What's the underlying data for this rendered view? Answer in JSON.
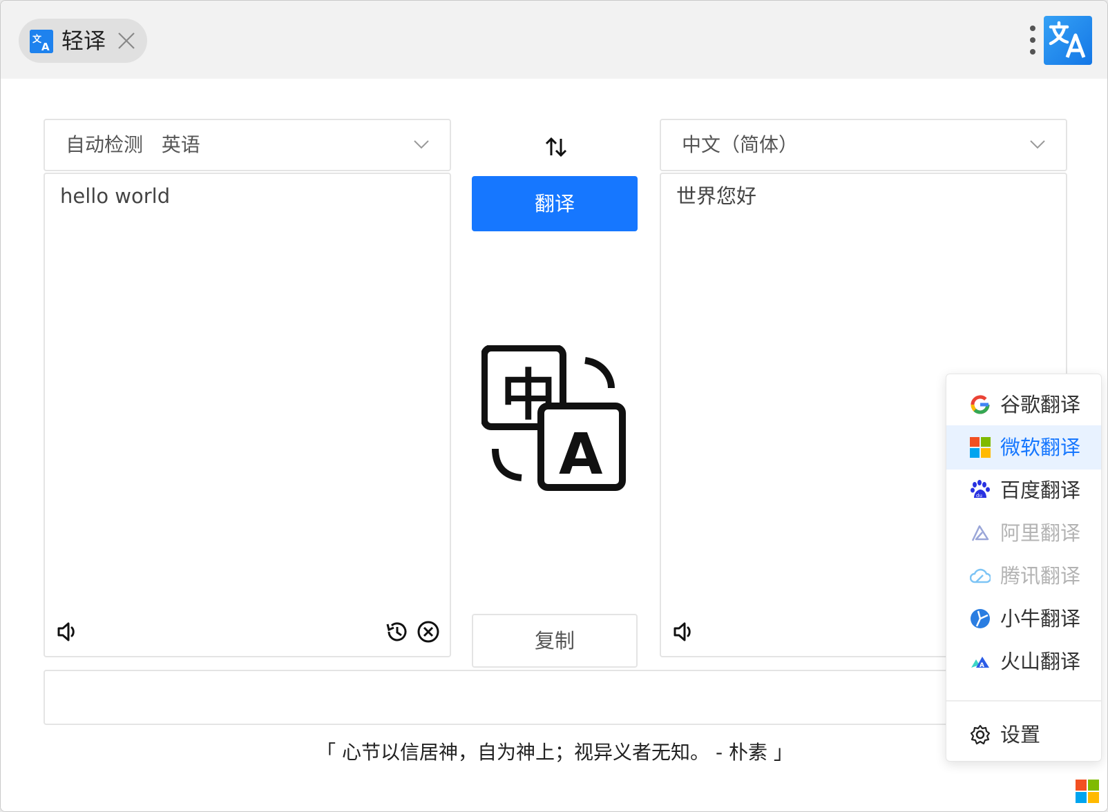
{
  "tab": {
    "title": "轻译",
    "icon": "translate-icon"
  },
  "source": {
    "language_label": "自动检测   英语",
    "text": "hello world"
  },
  "target": {
    "language_label": "中文（简体）",
    "text": "世界您好"
  },
  "buttons": {
    "translate": "翻译",
    "copy": "复制"
  },
  "quote": "「 心节以信居神，自为神上；视异义者无知。 - 朴素 」",
  "engines": [
    {
      "label": "谷歌翻译",
      "icon": "google-icon",
      "state": "normal"
    },
    {
      "label": "微软翻译",
      "icon": "microsoft-icon",
      "state": "selected"
    },
    {
      "label": "百度翻译",
      "icon": "baidu-icon",
      "state": "normal"
    },
    {
      "label": "阿里翻译",
      "icon": "alibaba-icon",
      "state": "disabled"
    },
    {
      "label": "腾讯翻译",
      "icon": "tencent-cloud-icon",
      "state": "disabled"
    },
    {
      "label": "小牛翻译",
      "icon": "niutrans-icon",
      "state": "normal"
    },
    {
      "label": "火山翻译",
      "icon": "volcano-icon",
      "state": "normal"
    }
  ],
  "settings_label": "设置",
  "colors": {
    "accent": "#1677ff",
    "text": "#333333",
    "border": "#e4e4e4",
    "disabled": "#b3b3b3"
  }
}
